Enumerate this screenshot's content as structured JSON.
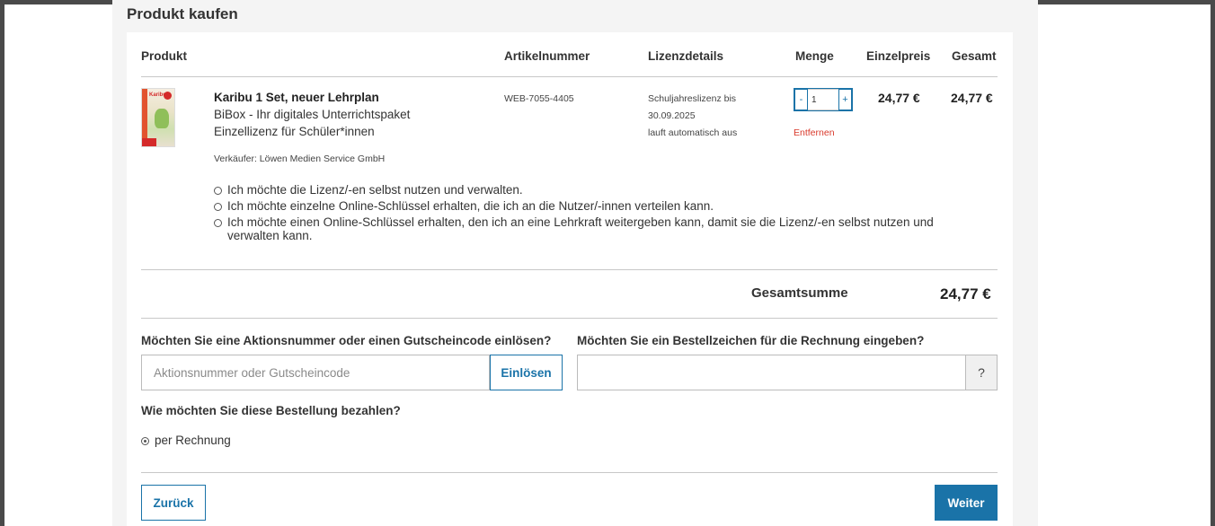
{
  "page": {
    "title": "Produkt kaufen"
  },
  "table": {
    "headers": {
      "product": "Produkt",
      "article": "Artikelnummer",
      "license": "Lizenzdetails",
      "quantity": "Menge",
      "unit_price": "Einzelpreis",
      "total": "Gesamt"
    }
  },
  "product": {
    "title": "Karibu 1 Set, neuer Lehrplan",
    "line2": "BiBox - Ihr digitales Unterrichtspaket",
    "line3": "Einzellizenz für Schüler*innen",
    "seller": "Verkäufer: Löwen Medien Service GmbH",
    "article_number": "WEB-7055-4405",
    "license_line1": "Schuljahreslizenz bis",
    "license_line2": "30.09.2025",
    "license_line3": "lauft automatisch aus",
    "quantity": "1",
    "qty_minus": "-",
    "qty_plus": "+",
    "remove_label": "Entfernen",
    "unit_price": "24,77 €",
    "total_price": "24,77 €",
    "cover_logo": "Karibu"
  },
  "license_options": [
    {
      "label": "Ich möchte die Lizenz/-en selbst nutzen und verwalten.",
      "selected": false
    },
    {
      "label": "Ich möchte einzelne Online-Schlüssel erhalten, die ich an die Nutzer/-innen verteilen kann.",
      "selected": false
    },
    {
      "label": "Ich möchte einen Online-Schlüssel erhalten, den ich an eine Lehrkraft weitergeben kann, damit sie die Lizenz/-en selbst nutzen und",
      "label_cont": "verwalten kann.",
      "selected": false
    }
  ],
  "summary": {
    "label": "Gesamtsumme",
    "value": "24,77 €"
  },
  "voucher": {
    "question": "Möchten Sie eine Aktionsnummer oder einen Gutscheincode einlösen?",
    "placeholder": "Aktionsnummer oder Gutscheincode",
    "value": "",
    "button": "Einlösen"
  },
  "order_ref": {
    "question": "Möchten Sie ein Bestellzeichen für die Rechnung eingeben?",
    "value": "",
    "help": "?"
  },
  "payment": {
    "question": "Wie möchten Sie diese Bestellung bezahlen?",
    "options": [
      {
        "label": "per Rechnung",
        "selected": true
      }
    ]
  },
  "nav": {
    "back": "Zurück",
    "next": "Weiter"
  },
  "colors": {
    "accent": "#1a73a8",
    "danger": "#d9392b",
    "frame": "#4a4a4a"
  }
}
